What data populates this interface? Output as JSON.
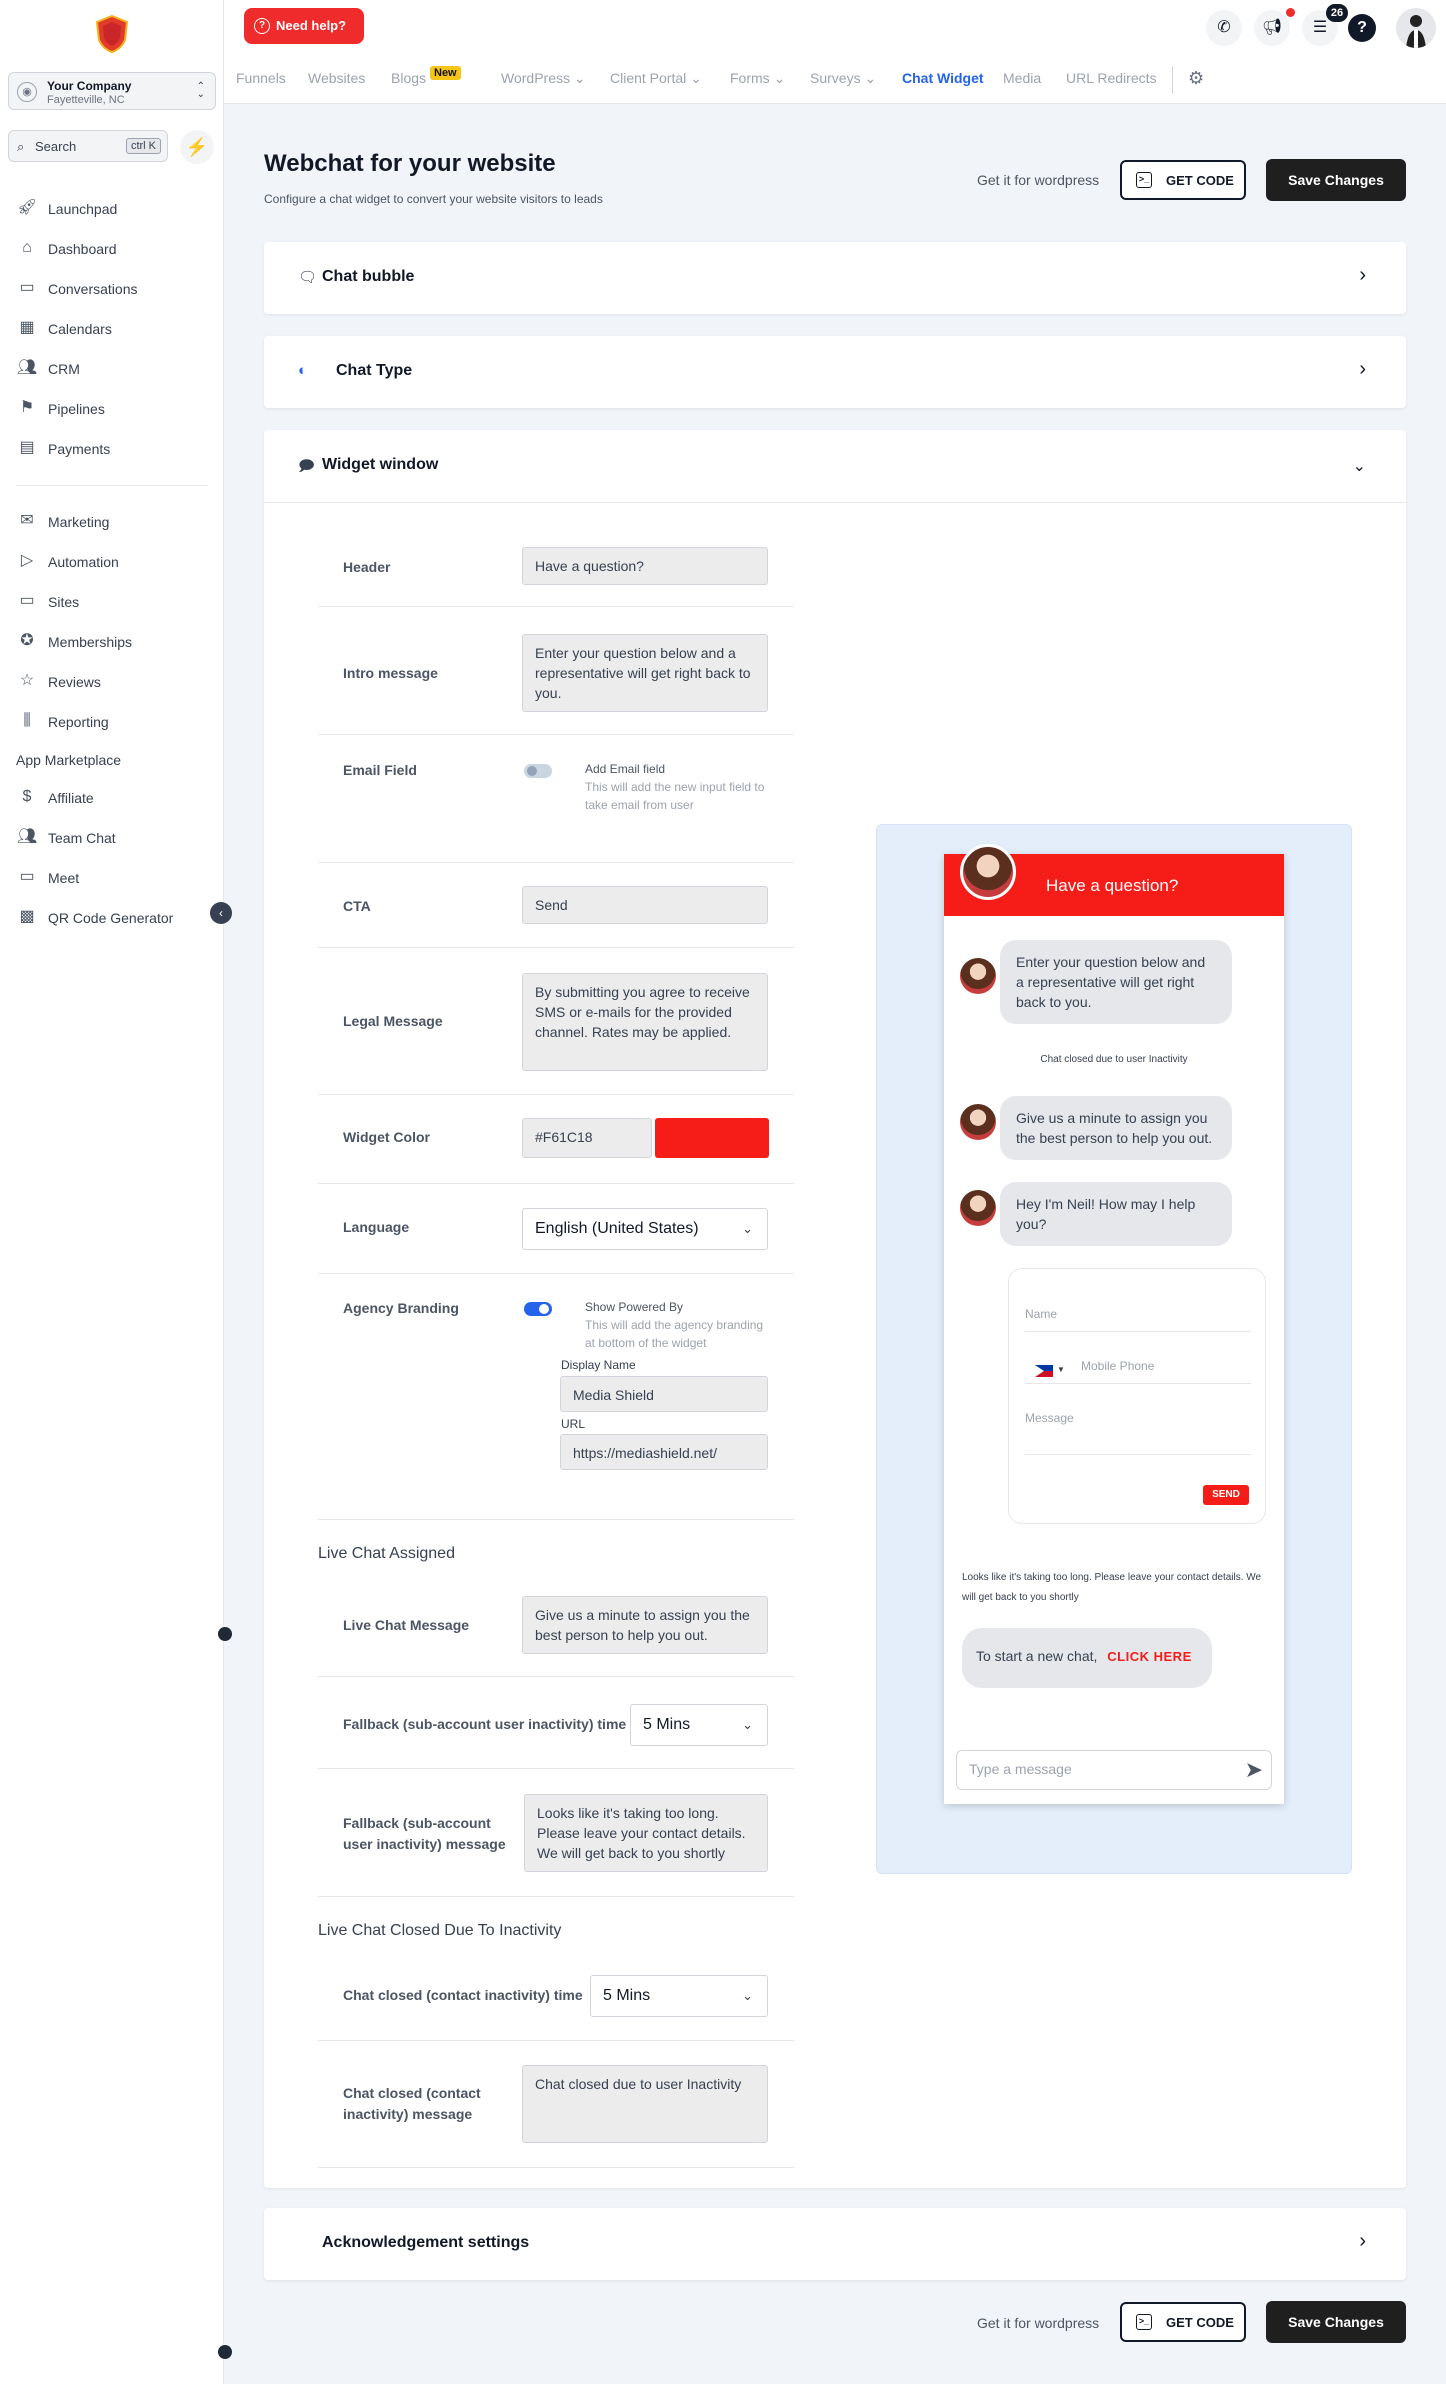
{
  "sidebar": {
    "company_name": "Your Company",
    "company_location": "Fayetteville, NC",
    "search_placeholder": "Search",
    "search_shortcut": "ctrl K",
    "items": [
      {
        "label": "Launchpad",
        "icon": "rocket-icon"
      },
      {
        "label": "Dashboard",
        "icon": "home-icon"
      },
      {
        "label": "Conversations",
        "icon": "chat-icon"
      },
      {
        "label": "Calendars",
        "icon": "calendar-icon"
      },
      {
        "label": "CRM",
        "icon": "users-icon"
      },
      {
        "label": "Pipelines",
        "icon": "flag-icon"
      },
      {
        "label": "Payments",
        "icon": "card-icon"
      },
      {
        "label": "Marketing",
        "icon": "mail-icon"
      },
      {
        "label": "Automation",
        "icon": "play-icon"
      },
      {
        "label": "Sites",
        "icon": "monitor-icon"
      },
      {
        "label": "Memberships",
        "icon": "award-icon"
      },
      {
        "label": "Reviews",
        "icon": "star-icon"
      },
      {
        "label": "Reporting",
        "icon": "bar-chart-icon"
      },
      {
        "label": "App Marketplace",
        "icon": ""
      },
      {
        "label": "Affiliate",
        "icon": "dollar-icon"
      },
      {
        "label": "Team Chat",
        "icon": "team-icon"
      },
      {
        "label": "Meet",
        "icon": "cast-icon"
      },
      {
        "label": "QR Code Generator",
        "icon": "qr-icon"
      }
    ]
  },
  "topbar": {
    "help_label": "Need help?",
    "notification_count": "26",
    "tabs": [
      {
        "label": "Funnels"
      },
      {
        "label": "Websites"
      },
      {
        "label": "Blogs",
        "badge": "New"
      },
      {
        "label": "WordPress",
        "dropdown": true
      },
      {
        "label": "Client Portal",
        "dropdown": true
      },
      {
        "label": "Forms",
        "dropdown": true
      },
      {
        "label": "Surveys",
        "dropdown": true
      },
      {
        "label": "Chat Widget",
        "active": true
      },
      {
        "label": "Media"
      },
      {
        "label": "URL Redirects"
      }
    ]
  },
  "header": {
    "title": "Webchat for your website",
    "subtitle": "Configure a chat widget to convert your website visitors to leads",
    "wordpress_text": "Get it for wordpress",
    "get_code_label": "GET CODE",
    "save_label": "Save Changes"
  },
  "sections": {
    "chat_bubble": "Chat bubble",
    "chat_type": "Chat Type",
    "widget_window": "Widget window",
    "acknowledgement": "Acknowledgement settings"
  },
  "form": {
    "header_label": "Header",
    "header_value": "Have a question?",
    "intro_label": "Intro message",
    "intro_value": "Enter your question below and a representative will get right back to you.",
    "email_label": "Email Field",
    "email_toggle_title": "Add Email field",
    "email_toggle_desc": "This will add the new input field to take email from user",
    "email_enabled": false,
    "cta_label": "CTA",
    "cta_value": "Send",
    "legal_label": "Legal Message",
    "legal_value": "By submitting you agree to receive SMS or e-mails for the provided channel. Rates may be applied.",
    "color_label": "Widget Color",
    "color_value": "#F61C18",
    "language_label": "Language",
    "language_value": "English (United States)",
    "branding_label": "Agency Branding",
    "branding_toggle_title": "Show Powered By",
    "branding_toggle_desc": "This will add the agency branding at bottom of the widget",
    "branding_enabled": true,
    "display_name_label": "Display Name",
    "display_name_value": "Media Shield",
    "url_label": "URL",
    "url_value": "https://mediashield.net/",
    "live_chat_section": "Live Chat Assigned",
    "live_msg_label": "Live Chat Message",
    "live_msg_value": "Give us a minute to assign you the best person to help you out.",
    "fallback_time_label": "Fallback (sub-account user inactivity) time",
    "fallback_time_value": "5 Mins",
    "fallback_msg_label": "Fallback (sub-account user inactivity) message",
    "fallback_msg_value": "Looks like it's taking too long. Please leave your contact details. We will get back to you shortly",
    "closed_section": "Live Chat Closed Due To Inactivity",
    "closed_time_label": "Chat closed (contact inactivity) time",
    "closed_time_value": "5 Mins",
    "closed_msg_label": "Chat closed (contact inactivity) message",
    "closed_msg_value": "Chat closed due to user Inactivity"
  },
  "preview": {
    "header_title": "Have a question?",
    "intro": "Enter your question below and a representative will get right back to you.",
    "closed_note": "Chat closed due to user Inactivity",
    "assign_msg": "Give us a minute to assign you the best person to help you out.",
    "greeting": "Hey I'm Neil! How may I help you?",
    "name_placeholder": "Name",
    "phone_placeholder": "Mobile Phone",
    "message_placeholder": "Message",
    "send_label": "SEND",
    "long_note": "Looks like it's taking too long. Please leave your contact details. We will get back to you shortly",
    "new_chat_text": "To start a new chat,",
    "new_chat_link": "CLICK HERE",
    "type_placeholder": "Type a message"
  },
  "colors": {
    "widget": "#F61C18",
    "accent_blue": "#2563eb",
    "toggle_on": "#2563eb",
    "toggle_off": "#cbd5e1"
  }
}
